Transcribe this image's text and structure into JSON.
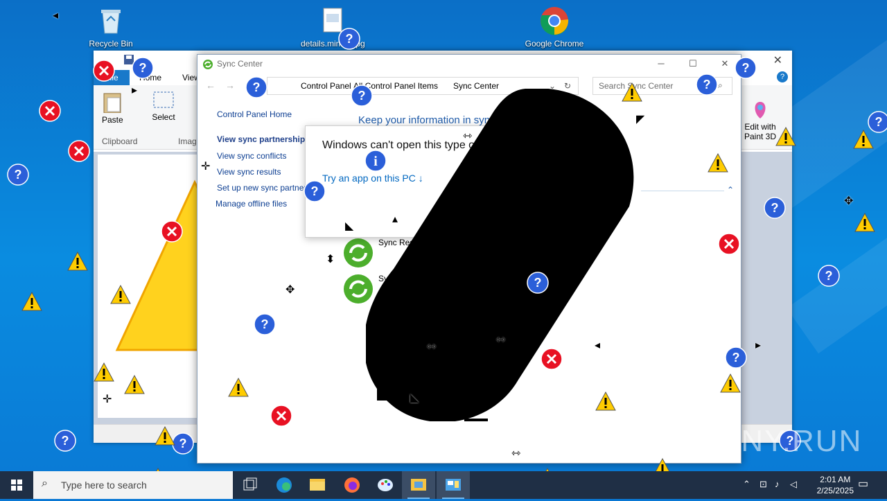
{
  "desktop": {
    "icons": [
      {
        "label": "Recycle Bin"
      },
      {
        "label": "details.mining.jpg"
      },
      {
        "label": "Google Chrome"
      }
    ]
  },
  "paint": {
    "tabs": [
      "File",
      "Home",
      "View"
    ],
    "ribbon": {
      "paste_label": "Paste",
      "clipboard_label": "Clipboard",
      "select_label": "Select",
      "image_label": "Image",
      "paint3d_label": "Edit with\nPaint 3D"
    }
  },
  "sync": {
    "title": "Sync Center",
    "breadcrumbs": [
      "Control Panel",
      "All Control Panel Items",
      "Sync Center"
    ],
    "search_placeholder": "Search Sync Center",
    "nav": {
      "home": "Control Panel Home",
      "items": [
        "View sync partnerships",
        "View sync conflicts",
        "View sync results",
        "Set up new sync partnerships",
        "Manage offline files"
      ]
    },
    "main_title": "Keep your information in sync",
    "list_items": [
      "Sync Results",
      "Sync"
    ]
  },
  "dialog": {
    "message": "Windows can't open this type of file",
    "link": "Try an app on this PC ↓"
  },
  "taskbar": {
    "search_placeholder": "Type here to search",
    "time": "2:01 AM",
    "date": "2/25/2025"
  },
  "watermark": "ANY.RUN",
  "colors": {
    "accent": "#0067c0",
    "desktop": "#0a78d4",
    "taskbar": "#1f2f45",
    "sync_icon": "#4cae2c"
  }
}
